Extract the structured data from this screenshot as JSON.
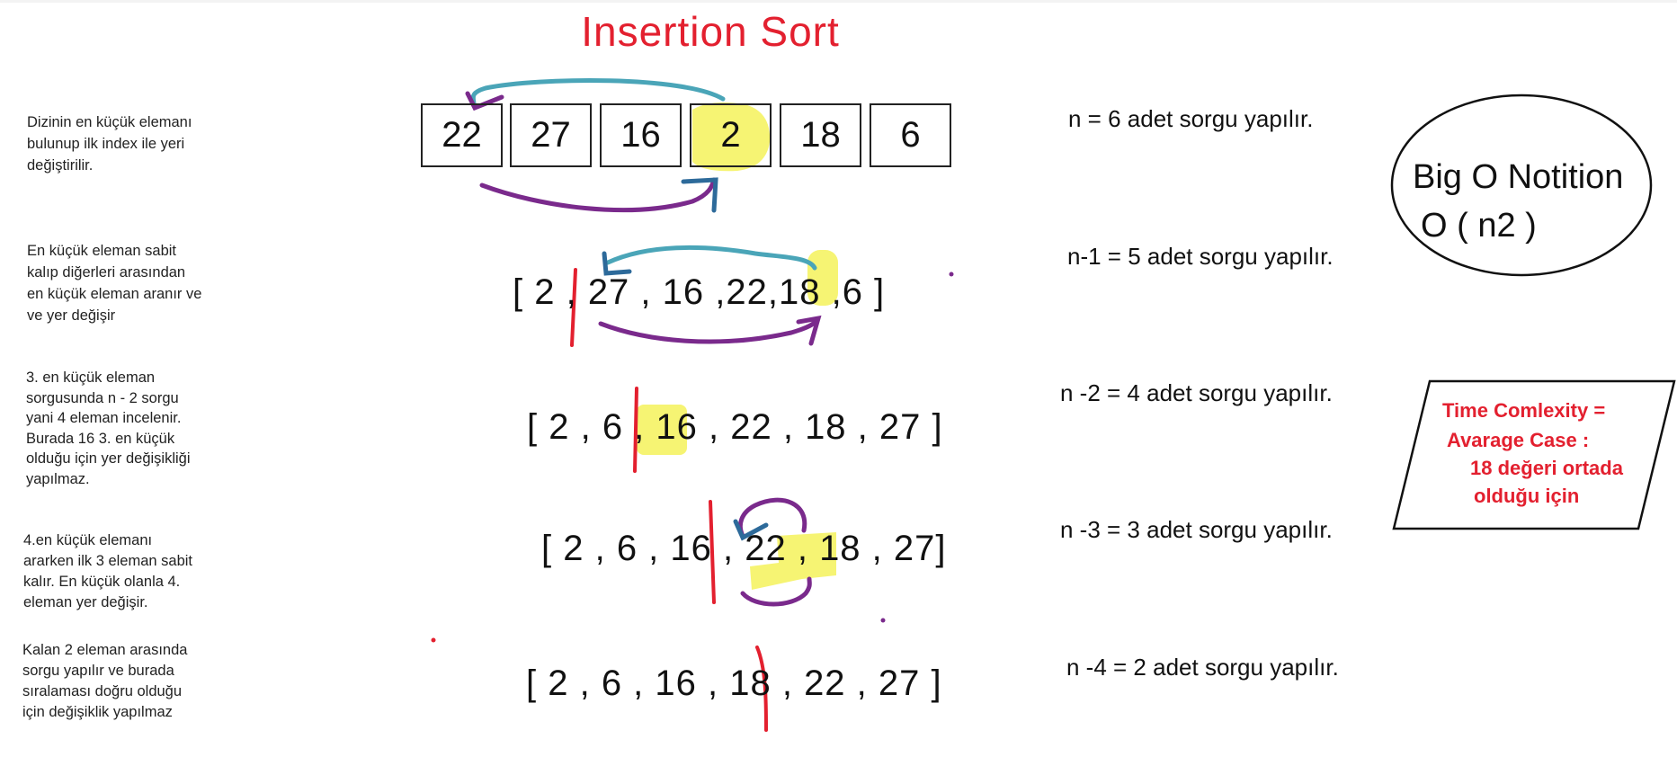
{
  "title": "Insertion Sort",
  "notes": [
    "Dizinin en küçük elemanı\nbulunup ilk index ile yeri\ndeğiştirilir.",
    "En küçük eleman sabit\nkalıp diğerleri arasından\nen küçük eleman aranır ve\nve yer değişir",
    "3. en küçük eleman\nsorgusunda n - 2 sorgu\nyani 4 eleman incelenir.\nBurada 16 3. en küçük\nolduğu için yer değişikliği\nyapılmaz.",
    "4.en küçük elemanı\nararken ilk 3 eleman sabit\nkalır. En küçük olanla 4.\neleman yer değişir.",
    "Kalan 2 eleman arasında\nsorgu yapılır ve burada\nsıralaması doğru olduğu\niçin değişiklik yapılmaz"
  ],
  "boxes": [
    "22",
    "27",
    "16",
    "2",
    "18",
    "6"
  ],
  "rows": [
    "[ 2 , 27 , 16 ,22,18 ,6 ]",
    "[ 2 , 6 , 16  , 22 , 18 , 27 ]",
    "[ 2 , 6 , 16 , 22 , 18 , 27]",
    "[ 2 , 6 , 16 , 18 , 22 , 27 ]"
  ],
  "counts": [
    "n = 6   adet sorgu yapılır.",
    "n-1 = 5  adet sorgu yapılır.",
    "n -2  = 4 adet sorgu yapılır.",
    "n -3 = 3 adet sorgu yapılır.",
    "n -4  = 2 adet sorgu yapılır."
  ],
  "big_o": {
    "line1": "Big O Notition",
    "line2": "O ( n2 )"
  },
  "time_complexity": {
    "line1": "Time Comlexity =",
    "line2": "Avarage Case :",
    "line3": "18 değeri ortada",
    "line4": "olduğu  için"
  },
  "colors": {
    "title": "#e3202f",
    "highlight": "#f5f25a",
    "divider": "#e3202f",
    "arrow": "#7a2a8c"
  }
}
